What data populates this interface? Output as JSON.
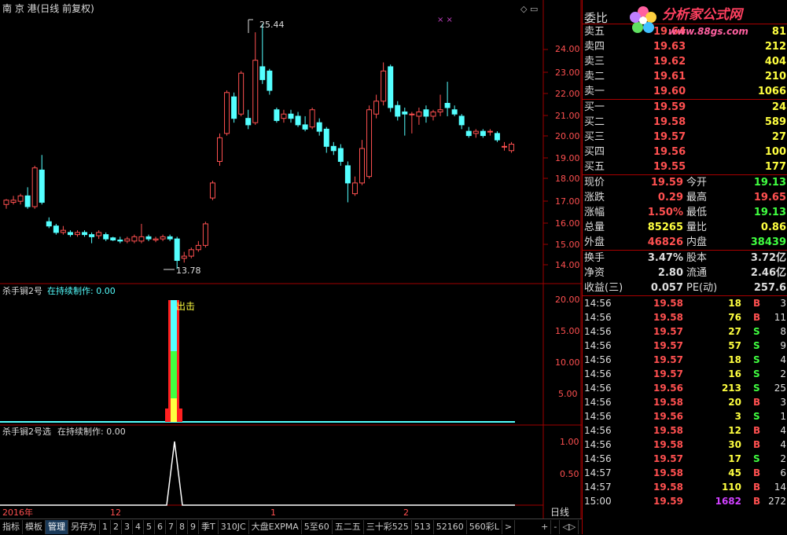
{
  "header": {
    "title": "南 京 港(日线 前复权)"
  },
  "price_axis": [
    "24.00",
    "23.00",
    "22.00",
    "21.00",
    "20.00",
    "19.00",
    "18.00",
    "17.00",
    "16.00",
    "15.00",
    "14.00"
  ],
  "annotations": {
    "high": "25.44",
    "low": "13.78",
    "signal": "出击"
  },
  "indicator1": {
    "name": "杀手锏2号",
    "status": "在持续制作: 0.00",
    "axis": [
      "20.00",
      "15.00",
      "10.00",
      "5.00"
    ]
  },
  "indicator2": {
    "name": "杀手锏2号选",
    "status": "在持续制作: 0.00",
    "axis": [
      "1.00",
      "0.50"
    ]
  },
  "date_axis": {
    "year": "2016年",
    "m12": "12",
    "m1": "1",
    "m2": "2",
    "period": "日线"
  },
  "bottom_tabs": [
    "指标",
    "模板",
    "管理",
    "另存为",
    "1",
    "2",
    "3",
    "4",
    "5",
    "6",
    "7",
    "8",
    "9",
    "季T",
    "310JC",
    "大盘EXPMA",
    "5至60",
    "五二五",
    "三十彩525",
    "513",
    "52160",
    "560彩L",
    ">"
  ],
  "bottom_controls": [
    "+",
    "-",
    "◁▷"
  ],
  "logo": {
    "name": "分析家公式网",
    "url": "www.88gs.com"
  },
  "order_book": {
    "ratio_label": "委比",
    "sells": [
      {
        "label": "卖五",
        "price": "19.64",
        "vol": "81"
      },
      {
        "label": "卖四",
        "price": "19.63",
        "vol": "212"
      },
      {
        "label": "卖三",
        "price": "19.62",
        "vol": "404"
      },
      {
        "label": "卖二",
        "price": "19.61",
        "vol": "210"
      },
      {
        "label": "卖一",
        "price": "19.60",
        "vol": "1066"
      }
    ],
    "buys": [
      {
        "label": "买一",
        "price": "19.59",
        "vol": "24"
      },
      {
        "label": "买二",
        "price": "19.58",
        "vol": "589"
      },
      {
        "label": "买三",
        "price": "19.57",
        "vol": "27"
      },
      {
        "label": "买四",
        "price": "19.56",
        "vol": "100"
      },
      {
        "label": "买五",
        "price": "19.55",
        "vol": "177"
      }
    ]
  },
  "quote": [
    {
      "l": "现价",
      "lv": "19.59",
      "r": "今开",
      "rv": "19.13"
    },
    {
      "l": "涨跌",
      "lv": "0.29",
      "r": "最高",
      "rv": "19.65"
    },
    {
      "l": "涨幅",
      "lv": "1.50%",
      "r": "最低",
      "rv": "19.13"
    },
    {
      "l": "总量",
      "lv": "85265",
      "r": "量比",
      "rv": "0.86"
    },
    {
      "l": "外盘",
      "lv": "46826",
      "r": "内盘",
      "rv": "38439"
    }
  ],
  "fundamentals": [
    {
      "l": "换手",
      "lv": "3.47%",
      "r": "股本",
      "rv": "3.72亿"
    },
    {
      "l": "净资",
      "lv": "2.80",
      "r": "流通",
      "rv": "2.46亿"
    },
    {
      "l": "收益(三)",
      "lv": "0.057",
      "r": "PE(动)",
      "rv": "257.6"
    }
  ],
  "ticks": [
    {
      "t": "14:56",
      "p": "19.58",
      "v": "18",
      "bs": "B",
      "n": "3"
    },
    {
      "t": "14:56",
      "p": "19.58",
      "v": "76",
      "bs": "B",
      "n": "11"
    },
    {
      "t": "14:56",
      "p": "19.57",
      "v": "27",
      "bs": "S",
      "n": "8"
    },
    {
      "t": "14:56",
      "p": "19.57",
      "v": "57",
      "bs": "S",
      "n": "9"
    },
    {
      "t": "14:56",
      "p": "19.57",
      "v": "18",
      "bs": "S",
      "n": "4"
    },
    {
      "t": "14:56",
      "p": "19.57",
      "v": "16",
      "bs": "S",
      "n": "2"
    },
    {
      "t": "14:56",
      "p": "19.56",
      "v": "213",
      "bs": "S",
      "n": "25"
    },
    {
      "t": "14:56",
      "p": "19.58",
      "v": "20",
      "bs": "B",
      "n": "3"
    },
    {
      "t": "14:56",
      "p": "19.56",
      "v": "3",
      "bs": "S",
      "n": "1"
    },
    {
      "t": "14:56",
      "p": "19.58",
      "v": "12",
      "bs": "B",
      "n": "4"
    },
    {
      "t": "14:56",
      "p": "19.58",
      "v": "30",
      "bs": "B",
      "n": "4"
    },
    {
      "t": "14:56",
      "p": "19.57",
      "v": "17",
      "bs": "S",
      "n": "2"
    },
    {
      "t": "14:57",
      "p": "19.58",
      "v": "45",
      "bs": "B",
      "n": "6"
    },
    {
      "t": "14:57",
      "p": "19.58",
      "v": "110",
      "bs": "B",
      "n": "14"
    },
    {
      "t": "15:00",
      "p": "19.59",
      "v": "1682",
      "bs": "B",
      "n": "272"
    }
  ],
  "colors": {
    "up": "#ff5050",
    "down": "#54ffff",
    "yellow": "#ffff40",
    "green": "#40ff40",
    "frame": "#a00000"
  }
}
